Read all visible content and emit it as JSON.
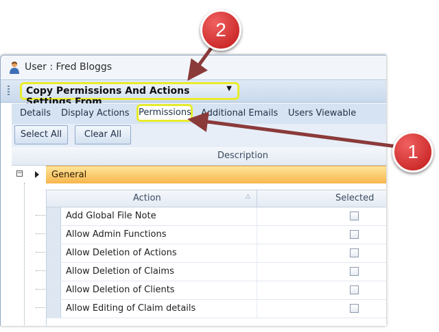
{
  "window": {
    "title": "User : Fred Bloggs"
  },
  "toolbar": {
    "copy_label": "Copy Permissions And Actions Settings From",
    "dropdown_icon": "chevron-down-icon"
  },
  "tabs": [
    {
      "label": "Details"
    },
    {
      "label": "Display Actions"
    },
    {
      "label": "Permissions",
      "active": true
    },
    {
      "label": "Additional Emails"
    },
    {
      "label": "Users Viewable"
    }
  ],
  "buttons": {
    "select_all": "Select All",
    "clear_all": "Clear All"
  },
  "grid": {
    "description_header": "Description",
    "group_label": "General",
    "expander": "−",
    "group_color": "#f8b64c"
  },
  "inner_grid": {
    "columns": [
      "Action",
      "Selected"
    ],
    "sort_glyph": "△",
    "rows": [
      {
        "action": "Add Global File Note",
        "selected": false
      },
      {
        "action": "Allow Admin Functions",
        "selected": false
      },
      {
        "action": "Allow Deletion of Actions",
        "selected": false
      },
      {
        "action": "Allow Deletion of Claims",
        "selected": false
      },
      {
        "action": "Allow Deletion of Clients",
        "selected": false
      },
      {
        "action": "Allow Editing of Claim details",
        "selected": false
      }
    ]
  },
  "annotations": {
    "one": "1",
    "two": "2",
    "highlight_color": "#e8ec2a",
    "marker_color": "#c01818",
    "arrow_color": "#8b3a3a"
  }
}
